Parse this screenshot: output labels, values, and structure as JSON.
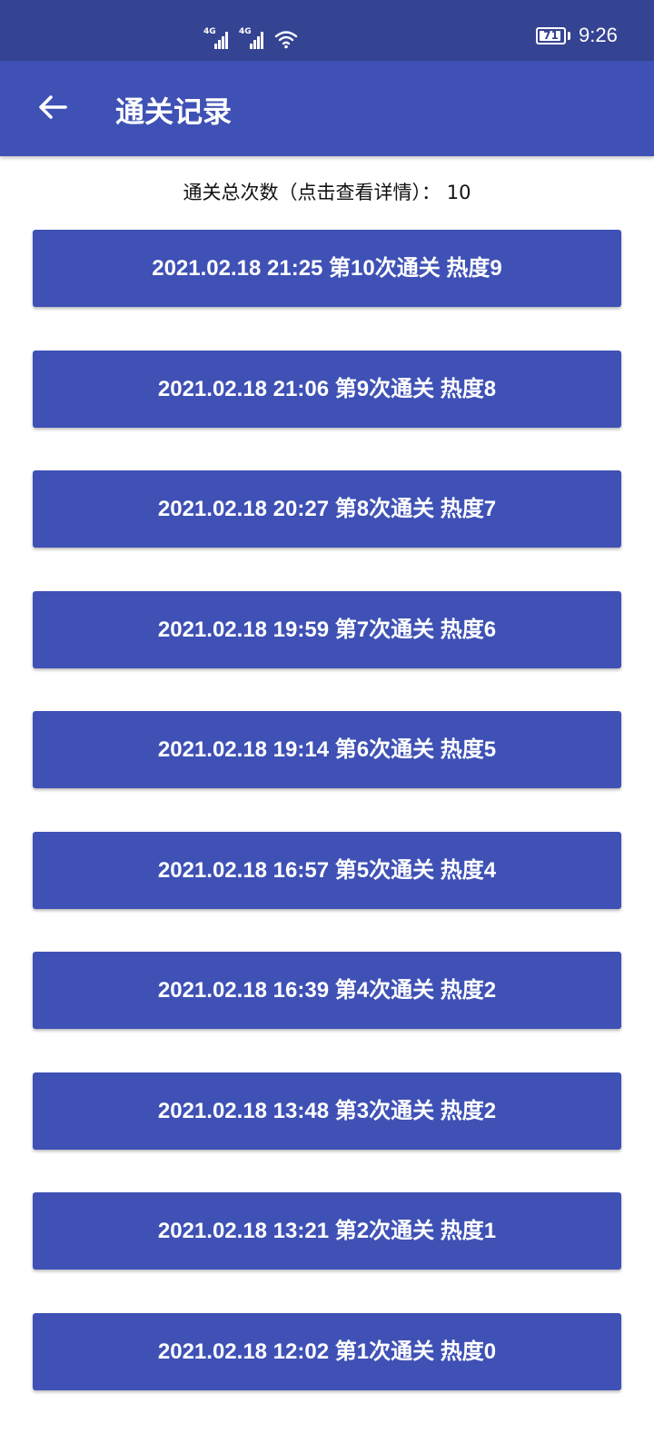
{
  "status_bar": {
    "signal1_label": "4G",
    "signal2_label": "4G",
    "battery_level": "71",
    "time": "9:26"
  },
  "app_bar": {
    "back_icon": "arrow-left-icon",
    "title": "通关记录"
  },
  "summary": {
    "text": "通关总次数（点击查看详情）：  10"
  },
  "records": [
    {
      "label": "2021.02.18 21:25 第10次通关 热度9"
    },
    {
      "label": "2021.02.18 21:06 第9次通关 热度8"
    },
    {
      "label": "2021.02.18 20:27 第8次通关 热度7"
    },
    {
      "label": "2021.02.18 19:59 第7次通关 热度6"
    },
    {
      "label": "2021.02.18 19:14 第6次通关 热度5"
    },
    {
      "label": "2021.02.18 16:57 第5次通关 热度4"
    },
    {
      "label": "2021.02.18 16:39 第4次通关 热度2"
    },
    {
      "label": "2021.02.18 13:48 第3次通关 热度2"
    },
    {
      "label": "2021.02.18 13:21 第2次通关 热度1"
    },
    {
      "label": "2021.02.18 12:02 第1次通关 热度0"
    }
  ],
  "colors": {
    "status_bar": "#354393",
    "primary": "#3f51b5",
    "text_on_primary": "#ffffff"
  }
}
